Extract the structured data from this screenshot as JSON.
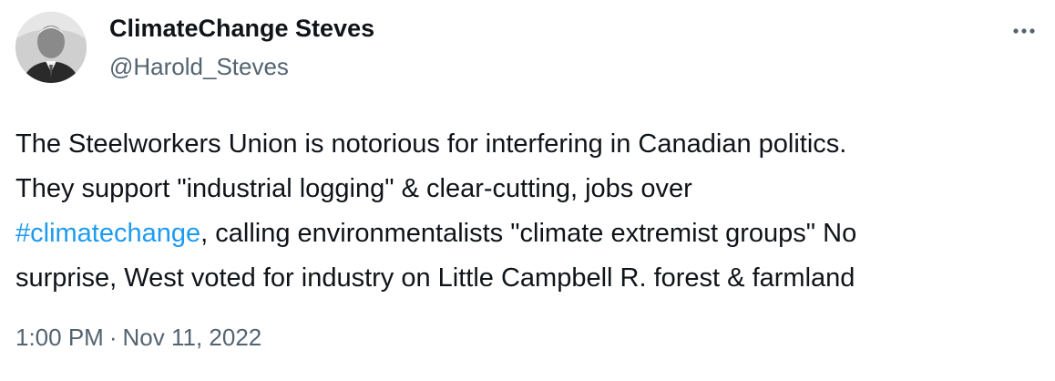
{
  "author": {
    "display_name": "ClimateChange Steves",
    "handle": "@Harold_Steves",
    "avatar_icon": "profile-photo"
  },
  "more_icon": "ellipsis-icon",
  "tweet": {
    "lines": [
      {
        "text": "The Steelworkers Union is notorious for interfering in Canadian politics."
      },
      {
        "text": "They support \"industrial logging\" & clear-cutting, jobs over"
      },
      {
        "hashtag": "#climatechange",
        "text": ", calling environmentalists \"climate extremist groups\" No"
      },
      {
        "text": "surprise, West voted for industry on Little Campbell R. forest & farmland"
      }
    ]
  },
  "timestamp": {
    "time": "1:00 PM",
    "separator": "·",
    "date": "Nov 11, 2022"
  },
  "colors": {
    "text": "#0f1419",
    "secondary": "#536471",
    "link": "#1d9bf0"
  }
}
